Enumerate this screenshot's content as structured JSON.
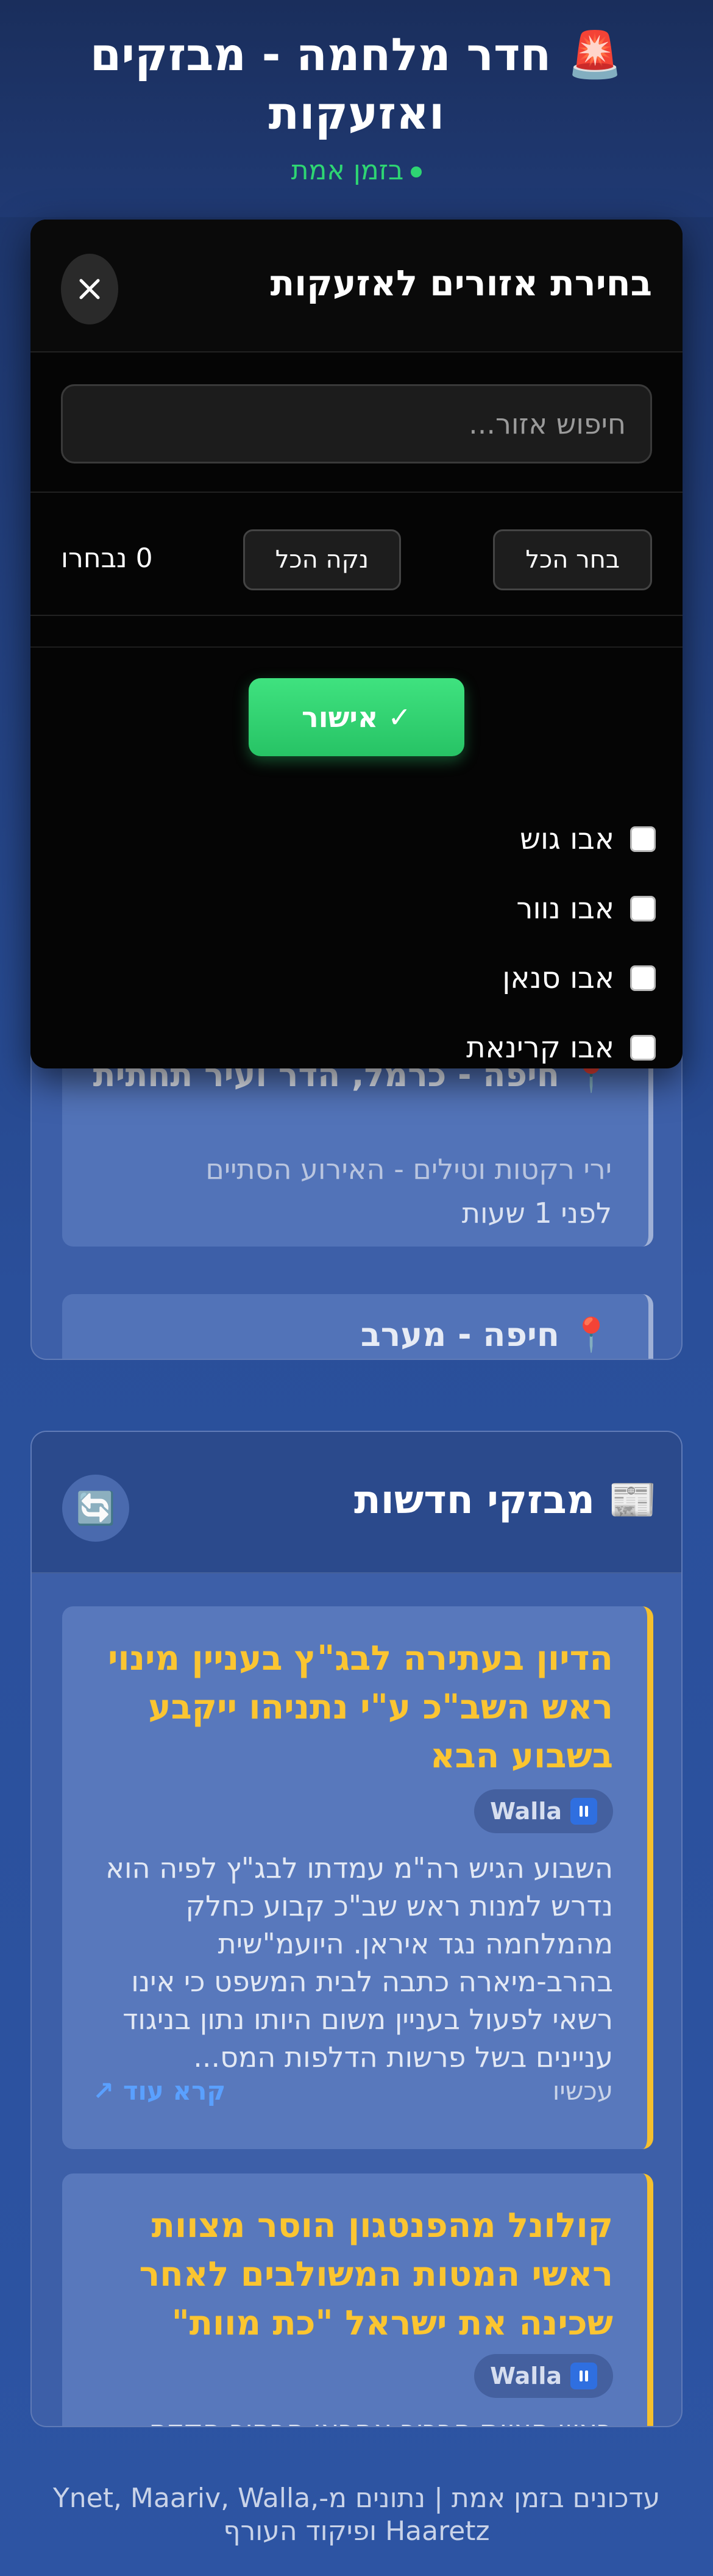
{
  "header": {
    "title": "🚨 חדר מלחמה - מבזקים ואזעקות",
    "live_label": "בזמן אמת"
  },
  "alerts": {
    "items": [
      {
        "title": "📍 חיפה - כרמל, הדר ועיר תחתית",
        "threat": "ירי רקטות וטילים - האירוע הסתיים",
        "time": "לפני 1 שעות"
      },
      {
        "title": "📍 חיפה - מערב"
      }
    ]
  },
  "news": {
    "heading": "📰 מבזקי חדשות",
    "refresh_icon": "🔄",
    "read_more": "קרא עוד ↗",
    "items": [
      {
        "title": "הדיון בעתירה לבג\"ץ בעניין מינוי ראש השב\"כ ע\"י נתניהו ייקבע בשבוע הבא",
        "source": "Walla",
        "body": "השבוע הגיש רה\"מ עמדתו לבג\"ץ לפיה הוא נדרש למנות ראש שב\"כ קבוע כחלק מהמלחמה נגד איראן. היועמ\"שית בהרב-מיארה כתבה לבית המשפט כי אינו רשאי לפעול בעניין משום היותו נתון בניגוד עניינים בשל פרשות הדלפות המס...",
        "time": "עכשיו"
      },
      {
        "title": "קולונל מהפנטגון הוסר מצוות ראשי המטות המשולבים לאחר שכינה את ישראל \"כת מוות\"",
        "source": "Walla",
        "body": "ראש הצוות הבכיר אחראי הבחיר הקדם"
      }
    ]
  },
  "footer": {
    "text": "עדכונים בזמן אמת | נתונים מ-Ynet, Maariv, Walla, Haaretz ופיקוד העורף"
  },
  "modal": {
    "title": "בחירת אזורים לאזעקות",
    "close_icon": "✕",
    "search_placeholder": "חיפוש אזור...",
    "select_all": "בחר הכל",
    "clear_all": "נקה הכל",
    "selected_count": "0 נבחרו",
    "confirm": "✓ אישור",
    "regions": [
      "אבו גוש",
      "אבו נוור",
      "אבו סנאן",
      "אבו קרינאת"
    ]
  },
  "colors": {
    "live_green": "#2ed573",
    "news_title_yellow": "#fbc531",
    "confirm_green": "#2ed573",
    "read_more_blue": "#5aa0ff"
  }
}
